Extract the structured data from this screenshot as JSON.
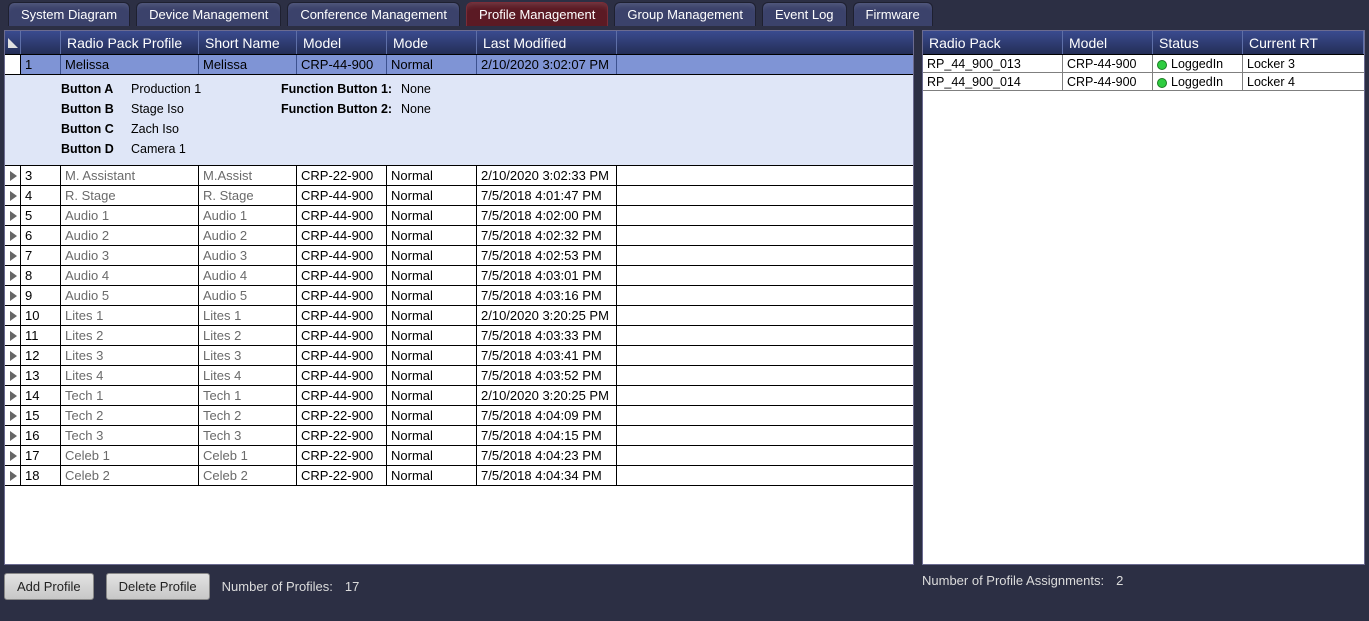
{
  "tabs": [
    {
      "label": "System Diagram",
      "active": false
    },
    {
      "label": "Device Management",
      "active": false
    },
    {
      "label": "Conference Management",
      "active": false
    },
    {
      "label": "Profile Management",
      "active": true
    },
    {
      "label": "Group Management",
      "active": false
    },
    {
      "label": "Event Log",
      "active": false
    },
    {
      "label": "Firmware",
      "active": false
    }
  ],
  "profile_table": {
    "columns": {
      "idx": "",
      "name": "Radio Pack Profile",
      "short": "Short Name",
      "model": "Model",
      "mode": "Mode",
      "date": "Last Modified"
    },
    "selected_index": 0,
    "selected_detail": {
      "button_a": {
        "label": "Button A",
        "value": "Production 1"
      },
      "button_b": {
        "label": "Button B",
        "value": "Stage Iso"
      },
      "button_c": {
        "label": "Button C",
        "value": "Zach Iso"
      },
      "button_d": {
        "label": "Button D",
        "value": "Camera 1"
      },
      "func1": {
        "label": "Function Button 1:",
        "value": "None"
      },
      "func2": {
        "label": "Function Button 2:",
        "value": "None"
      }
    },
    "rows": [
      {
        "idx": "1",
        "name": "Melissa",
        "short": "Melissa",
        "model": "CRP-44-900",
        "mode": "Normal",
        "date": "2/10/2020 3:02:07 PM"
      },
      {
        "idx": "3",
        "name": "M. Assistant",
        "short": "M.Assist",
        "model": "CRP-22-900",
        "mode": "Normal",
        "date": "2/10/2020 3:02:33 PM"
      },
      {
        "idx": "4",
        "name": "R. Stage",
        "short": "R. Stage",
        "model": "CRP-44-900",
        "mode": "Normal",
        "date": "7/5/2018 4:01:47 PM"
      },
      {
        "idx": "5",
        "name": "Audio 1",
        "short": "Audio 1",
        "model": "CRP-44-900",
        "mode": "Normal",
        "date": "7/5/2018 4:02:00 PM"
      },
      {
        "idx": "6",
        "name": "Audio 2",
        "short": "Audio 2",
        "model": "CRP-44-900",
        "mode": "Normal",
        "date": "7/5/2018 4:02:32 PM"
      },
      {
        "idx": "7",
        "name": "Audio 3",
        "short": "Audio 3",
        "model": "CRP-44-900",
        "mode": "Normal",
        "date": "7/5/2018 4:02:53 PM"
      },
      {
        "idx": "8",
        "name": "Audio 4",
        "short": "Audio 4",
        "model": "CRP-44-900",
        "mode": "Normal",
        "date": "7/5/2018 4:03:01 PM"
      },
      {
        "idx": "9",
        "name": "Audio 5",
        "short": "Audio 5",
        "model": "CRP-44-900",
        "mode": "Normal",
        "date": "7/5/2018 4:03:16 PM"
      },
      {
        "idx": "10",
        "name": "Lites 1",
        "short": "Lites 1",
        "model": "CRP-44-900",
        "mode": "Normal",
        "date": "2/10/2020 3:20:25 PM"
      },
      {
        "idx": "11",
        "name": "Lites 2",
        "short": "Lites 2",
        "model": "CRP-44-900",
        "mode": "Normal",
        "date": "7/5/2018 4:03:33 PM"
      },
      {
        "idx": "12",
        "name": "Lites 3",
        "short": "Lites 3",
        "model": "CRP-44-900",
        "mode": "Normal",
        "date": "7/5/2018 4:03:41 PM"
      },
      {
        "idx": "13",
        "name": "Lites 4",
        "short": "Lites 4",
        "model": "CRP-44-900",
        "mode": "Normal",
        "date": "7/5/2018 4:03:52 PM"
      },
      {
        "idx": "14",
        "name": "Tech 1",
        "short": "Tech 1",
        "model": "CRP-44-900",
        "mode": "Normal",
        "date": "2/10/2020 3:20:25 PM"
      },
      {
        "idx": "15",
        "name": "Tech 2",
        "short": "Tech 2",
        "model": "CRP-22-900",
        "mode": "Normal",
        "date": "7/5/2018 4:04:09 PM"
      },
      {
        "idx": "16",
        "name": "Tech 3",
        "short": "Tech 3",
        "model": "CRP-22-900",
        "mode": "Normal",
        "date": "7/5/2018 4:04:15 PM"
      },
      {
        "idx": "17",
        "name": "Celeb 1",
        "short": "Celeb 1",
        "model": "CRP-22-900",
        "mode": "Normal",
        "date": "7/5/2018 4:04:23 PM"
      },
      {
        "idx": "18",
        "name": "Celeb 2",
        "short": "Celeb 2",
        "model": "CRP-22-900",
        "mode": "Normal",
        "date": "7/5/2018 4:04:34 PM"
      }
    ]
  },
  "buttons": {
    "add": "Add Profile",
    "delete": "Delete Profile"
  },
  "counts": {
    "profiles_label": "Number of Profiles:",
    "profiles_value": "17",
    "assignments_label": "Number of Profile Assignments:",
    "assignments_value": "2"
  },
  "right_table": {
    "columns": {
      "rp": "Radio Pack",
      "model": "Model",
      "status": "Status",
      "rt": "Current RT"
    },
    "rows": [
      {
        "rp": "RP_44_900_013",
        "model": "CRP-44-900",
        "status": "LoggedIn",
        "rt": "Locker 3"
      },
      {
        "rp": "RP_44_900_014",
        "model": "CRP-44-900",
        "status": "LoggedIn",
        "rt": "Locker 4"
      }
    ]
  }
}
